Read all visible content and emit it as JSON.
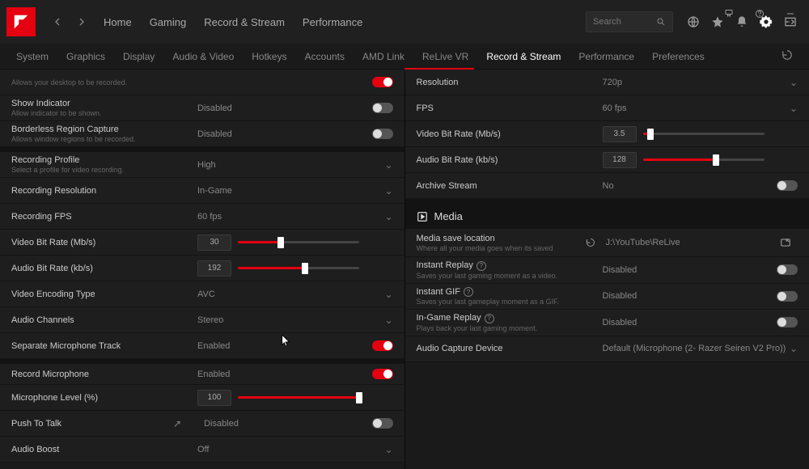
{
  "app": {
    "search_placeholder": "Search"
  },
  "top_nav": [
    "Home",
    "Gaming",
    "Record & Stream",
    "Performance"
  ],
  "subtabs": [
    "System",
    "Graphics",
    "Display",
    "Audio & Video",
    "Hotkeys",
    "Accounts",
    "AMD Link",
    "ReLive VR",
    "Record & Stream",
    "Performance",
    "Preferences"
  ],
  "active_subtab": "Record & Stream",
  "left": {
    "desktop_rec_sub": "Allows your desktop to be recorded.",
    "show_indicator": "Show Indicator",
    "show_indicator_sub": "Allow indicator to be shown.",
    "show_indicator_val": "Disabled",
    "borderless": "Borderless Region Capture",
    "borderless_sub": "Allows window regions to be recorded.",
    "borderless_val": "Disabled",
    "rec_profile": "Recording Profile",
    "rec_profile_sub": "Select a profile for video recording.",
    "rec_profile_val": "High",
    "rec_res": "Recording Resolution",
    "rec_res_val": "In-Game",
    "rec_fps": "Recording FPS",
    "rec_fps_val": "60 fps",
    "vbr": "Video Bit Rate (Mb/s)",
    "vbr_val": "30",
    "abr": "Audio Bit Rate (kb/s)",
    "abr_val": "192",
    "venc": "Video Encoding Type",
    "venc_val": "AVC",
    "ach": "Audio Channels",
    "ach_val": "Stereo",
    "sep_mic": "Separate Microphone Track",
    "sep_mic_val": "Enabled",
    "rec_mic": "Record Microphone",
    "rec_mic_val": "Enabled",
    "mic_lvl": "Microphone Level (%)",
    "mic_lvl_val": "100",
    "ptt": "Push To Talk",
    "ptt_val": "Disabled",
    "boost": "Audio Boost",
    "boost_val": "Off"
  },
  "right": {
    "res": "Resolution",
    "res_val": "720p",
    "fps": "FPS",
    "fps_val": "60 fps",
    "vbr": "Video Bit Rate (Mb/s)",
    "vbr_val": "3.5",
    "abr": "Audio Bit Rate (kb/s)",
    "abr_val": "128",
    "archive": "Archive Stream",
    "archive_val": "No",
    "media_header": "Media",
    "save_loc": "Media save location",
    "save_loc_sub": "Where all your media goes when its saved",
    "save_loc_val": "J:\\YouTube\\ReLive",
    "replay": "Instant Replay",
    "replay_sub": "Saves your last gaming moment as a video.",
    "replay_val": "Disabled",
    "gif": "Instant GIF",
    "gif_sub": "Saves your last gameplay moment as a GIF.",
    "gif_val": "Disabled",
    "igr": "In-Game Replay",
    "igr_sub": "Plays back your last gaming moment.",
    "igr_val": "Disabled",
    "acd": "Audio Capture Device",
    "acd_val": "Default (Microphone (2- Razer Seiren V2 Pro))"
  },
  "sliders": {
    "left_vbr_pct": 35,
    "left_abr_pct": 55,
    "left_mic_pct": 100,
    "right_vbr_pct": 6,
    "right_abr_pct": 60
  }
}
